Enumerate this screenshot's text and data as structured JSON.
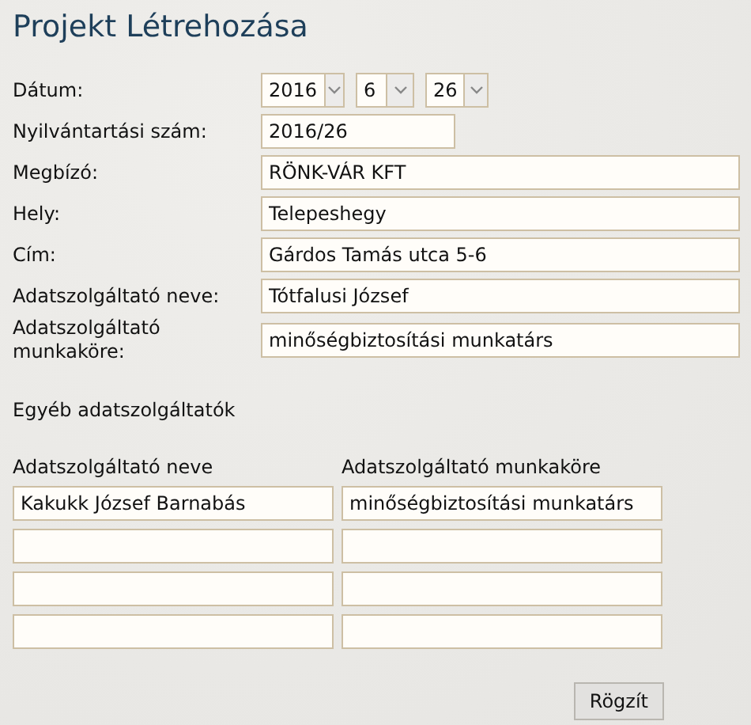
{
  "title": "Projekt Létrehozása",
  "fields": [
    {
      "kind": "date",
      "label": "Dátum:",
      "parts": [
        "2016",
        "6",
        "26"
      ]
    },
    {
      "kind": "short",
      "label": "Nyilvántartási szám:",
      "value": "2016/26"
    },
    {
      "kind": "text",
      "label": "Megbízó:",
      "value": "RÖNK-VÁR KFT"
    },
    {
      "kind": "text",
      "label": "Hely:",
      "value": "Telepeshegy"
    },
    {
      "kind": "text",
      "label": "Cím:",
      "value": "Gárdos Tamás utca 5-6"
    },
    {
      "kind": "text",
      "label": "Adatszolgáltató neve:",
      "value": "Tótfalusi József"
    },
    {
      "kind": "text",
      "label": "Adatszolgáltató munkaköre:",
      "value": "minőségbiztosítási munkatárs"
    }
  ],
  "others": {
    "heading": "Egyéb adatszolgáltatók",
    "columns": [
      "Adatszolgáltató neve",
      "Adatszolgáltató munkaköre"
    ],
    "rows": [
      {
        "cells": [
          "Kakukk József Barnabás",
          "minőségbiztosítási munkatárs"
        ]
      },
      {
        "cells": []
      },
      {
        "cells": []
      },
      {
        "cells": []
      }
    ]
  },
  "buttons": [
    "Rögzít"
  ]
}
